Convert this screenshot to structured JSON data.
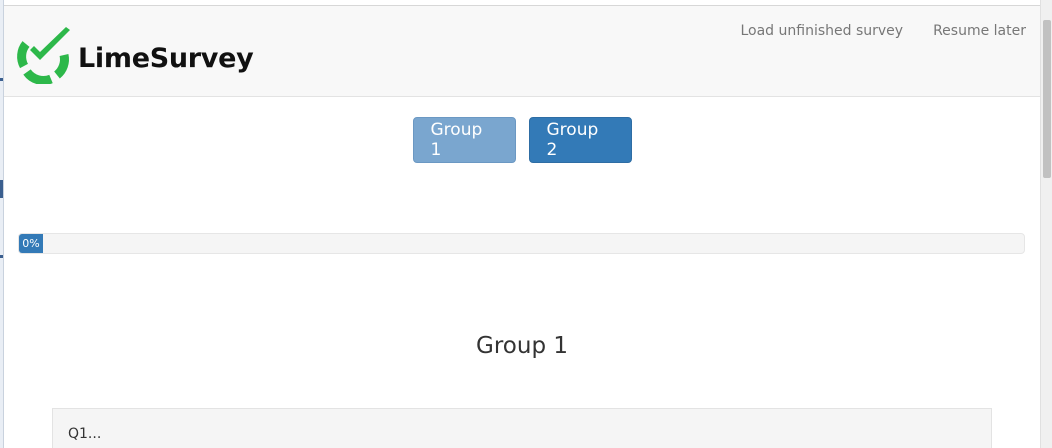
{
  "header": {
    "brand_name": "LimeSurvey",
    "nav_links": {
      "load_unfinished": "Load unfinished survey",
      "resume_later": "Resume later"
    }
  },
  "group_nav": {
    "groups": [
      {
        "label": "Group 1",
        "state": "inactive"
      },
      {
        "label": "Group 2",
        "state": "active"
      }
    ]
  },
  "progress": {
    "value_percent": 0,
    "label": "0%"
  },
  "main": {
    "group_title": "Group 1",
    "question_text": "Q1..."
  },
  "colors": {
    "primary": "#337ab7",
    "primary_light": "#7aa6cf",
    "brand_green": "#2db84a",
    "navbar_bg": "#f8f8f8"
  },
  "icons": [
    "limesurvey-logo-icon"
  ]
}
